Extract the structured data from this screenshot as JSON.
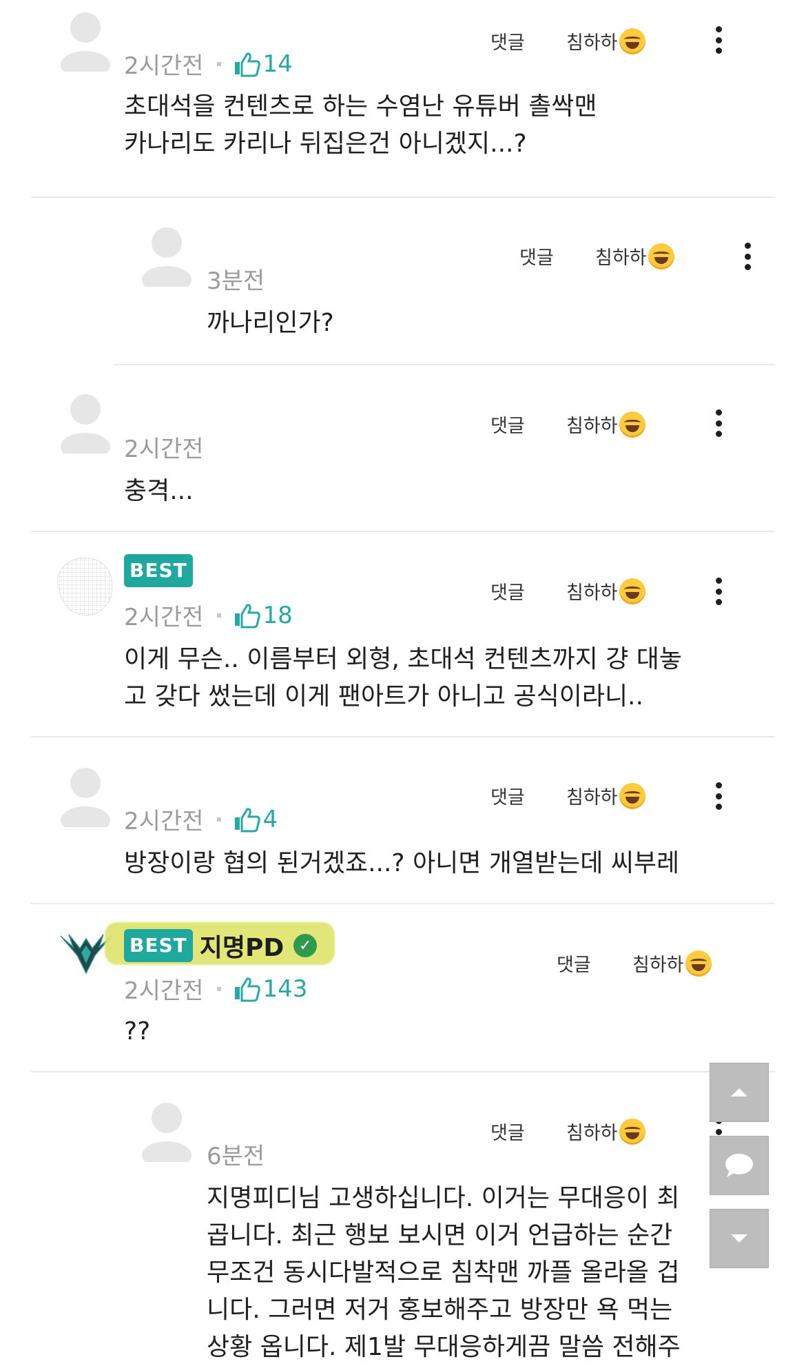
{
  "actions": {
    "reply_label": "댓글",
    "laugh_label": "침하하",
    "laugh_emoji": "😂"
  },
  "best_label": "BEST",
  "comments": [
    {
      "time": "2시간전",
      "likes": "14",
      "text": "초대석을 컨텐츠로 하는 수염난 유튜버 촐싹맨\n카나리도 카리나 뒤집은건 아니겠지...?"
    },
    {
      "time": "3분전",
      "text": "까나리인가?"
    },
    {
      "time": "2시간전",
      "text": "충격..."
    },
    {
      "time": "2시간전",
      "likes": "18",
      "best": true,
      "text": "이게 무슨.. 이름부터 외형, 초대석 컨텐츠까지 걍 대놓\n고 갖다 썼는데 이게 팬아트가 아니고 공식이라니.."
    },
    {
      "time": "2시간전",
      "likes": "4",
      "text": "방장이랑 협의 된거겠죠...? 아니면 개열받는데 씨부레"
    },
    {
      "time": "2시간전",
      "likes": "143",
      "best": true,
      "nickname": "지명PD",
      "verified": true,
      "text": "??"
    },
    {
      "time": "6분전",
      "text": "지명피디님 고생하십니다. 이거는 무대응이 최\n곱니다. 최근 행보 보시면 이거 언급하는 순간\n무조건 동시다발적으로 침착맨 까플 올라올 겁\n니다. 그러면 저거 홍보해주고 방장만 욕 먹는\n상황 옵니다. 제1발 무대응하게끔 말씀 전해주"
    }
  ],
  "floating": {
    "up_icon": "arrow-up-icon",
    "chat_icon": "chat-icon",
    "down_icon": "arrow-down-icon"
  }
}
